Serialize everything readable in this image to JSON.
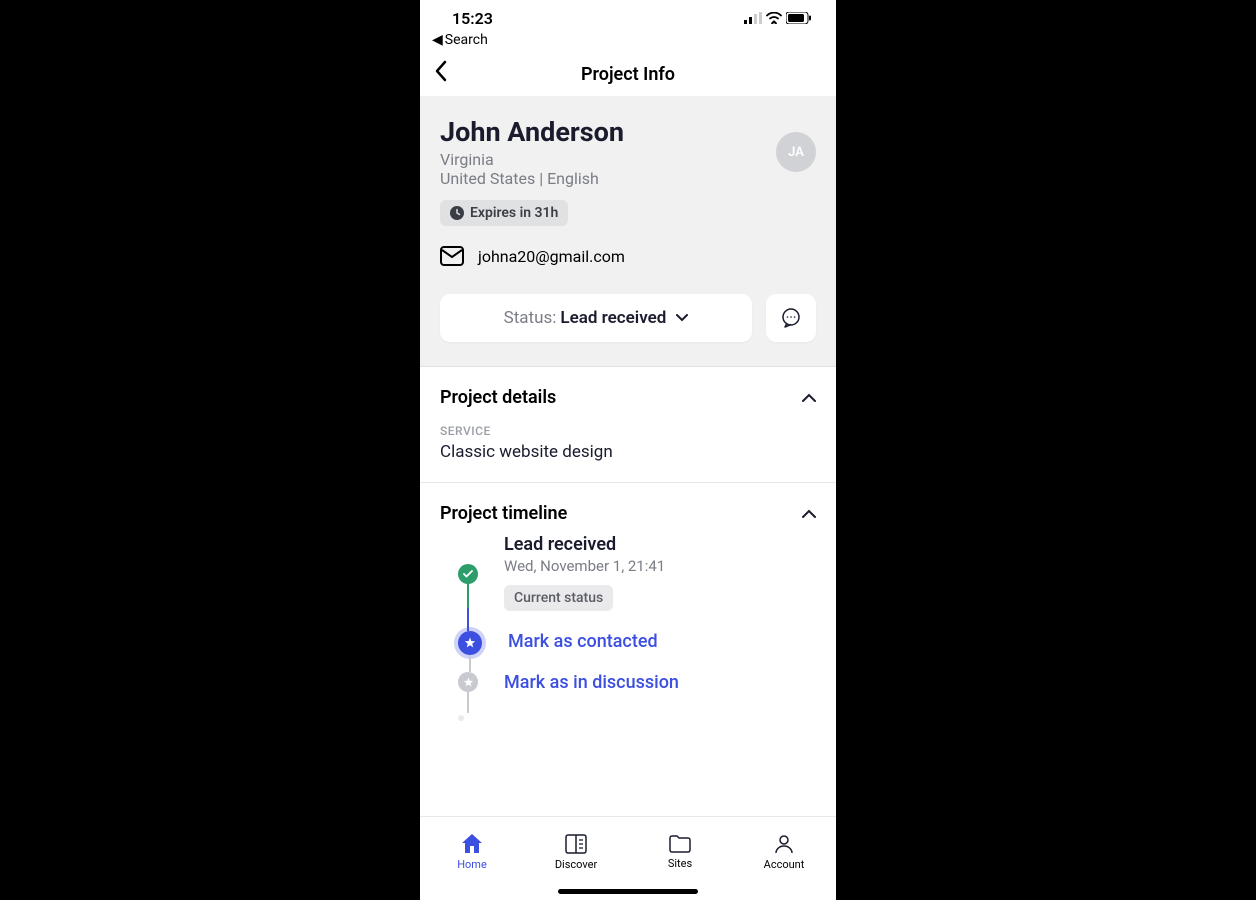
{
  "statusBar": {
    "time": "15:23"
  },
  "backSearch": {
    "label": "Search"
  },
  "header": {
    "title": "Project Info"
  },
  "profile": {
    "name": "John Anderson",
    "location": "Virginia",
    "countryLang": "United States | English",
    "avatarInitials": "JA",
    "expiresLabel": "Expires in 31h",
    "email": "johna20@gmail.com"
  },
  "status": {
    "prefix": "Status: ",
    "value": "Lead received"
  },
  "details": {
    "header": "Project details",
    "serviceLabel": "Service",
    "serviceValue": "Classic website design"
  },
  "timeline": {
    "header": "Project timeline",
    "items": [
      {
        "title": "Lead received",
        "subtitle": "Wed, November 1, 21:41",
        "badge": "Current status"
      },
      {
        "title": "Mark as contacted"
      },
      {
        "title": "Mark as in discussion"
      }
    ]
  },
  "bottomNav": {
    "items": [
      {
        "label": "Home"
      },
      {
        "label": "Discover"
      },
      {
        "label": "Sites"
      },
      {
        "label": "Account"
      }
    ]
  }
}
